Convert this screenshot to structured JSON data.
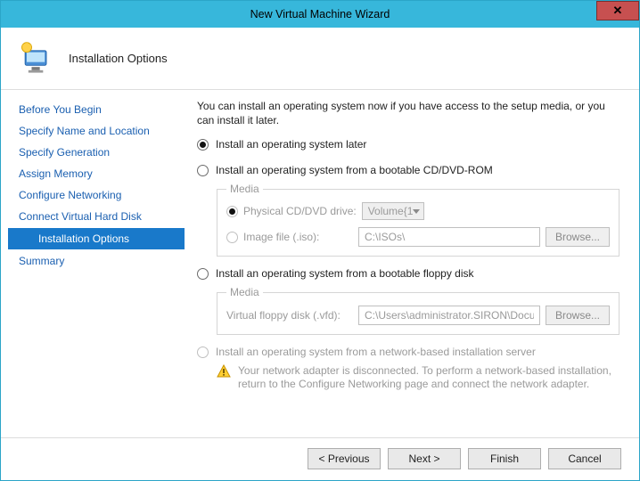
{
  "window": {
    "title": "New Virtual Machine Wizard",
    "close_glyph": "✕"
  },
  "header": {
    "title": "Installation Options"
  },
  "sidebar": {
    "items": [
      {
        "label": "Before You Begin",
        "selected": false
      },
      {
        "label": "Specify Name and Location",
        "selected": false
      },
      {
        "label": "Specify Generation",
        "selected": false
      },
      {
        "label": "Assign Memory",
        "selected": false
      },
      {
        "label": "Configure Networking",
        "selected": false
      },
      {
        "label": "Connect Virtual Hard Disk",
        "selected": false
      },
      {
        "label": "Installation Options",
        "selected": true
      },
      {
        "label": "Summary",
        "selected": false
      }
    ]
  },
  "main": {
    "intro": "You can install an operating system now if you have access to the setup media, or you can install it later.",
    "opt_later": "Install an operating system later",
    "opt_cd": "Install an operating system from a bootable CD/DVD-ROM",
    "cd_group": {
      "legend": "Media",
      "physical_label": "Physical CD/DVD drive:",
      "physical_value": "Volume{1",
      "image_label": "Image file (.iso):",
      "image_value": "C:\\ISOs\\",
      "browse": "Browse..."
    },
    "opt_floppy": "Install an operating system from a bootable floppy disk",
    "floppy_group": {
      "legend": "Media",
      "vfd_label": "Virtual floppy disk (.vfd):",
      "vfd_value": "C:\\Users\\administrator.SIRON\\Documents\\",
      "browse": "Browse..."
    },
    "opt_network": "Install an operating system from a network-based installation server",
    "network_warn": "Your network adapter is disconnected. To perform a network-based installation, return to the Configure Networking page and connect the network adapter."
  },
  "footer": {
    "previous": "< Previous",
    "next": "Next >",
    "finish": "Finish",
    "cancel": "Cancel"
  }
}
